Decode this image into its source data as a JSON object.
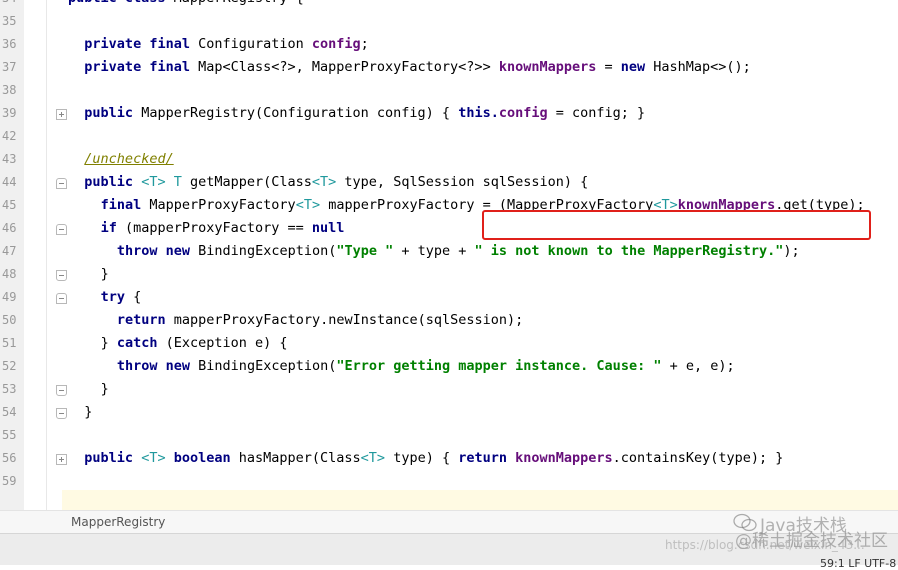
{
  "editor": {
    "lines": [
      {
        "no": "34",
        "indent": 0,
        "fold": "",
        "tokens": [
          [
            "kw",
            "public class "
          ],
          [
            "",
            "MapperRegistry {"
          ]
        ]
      },
      {
        "no": "35",
        "indent": 0,
        "fold": "",
        "tokens": []
      },
      {
        "no": "36",
        "indent": 1,
        "fold": "",
        "tokens": [
          [
            "kw",
            "private final "
          ],
          [
            "",
            "Configuration "
          ],
          [
            "fld",
            "config"
          ],
          [
            "",
            ";"
          ]
        ]
      },
      {
        "no": "37",
        "indent": 1,
        "fold": "",
        "tokens": [
          [
            "kw",
            "private final "
          ],
          [
            "",
            "Map<Class<?>, MapperProxyFactory<?>> "
          ],
          [
            "fld",
            "knownMappers"
          ],
          [
            "",
            " = "
          ],
          [
            "kw",
            "new "
          ],
          [
            "",
            "HashMap<>();"
          ]
        ]
      },
      {
        "no": "38",
        "indent": 0,
        "fold": "",
        "tokens": []
      },
      {
        "no": "39",
        "indent": 1,
        "fold": "plus",
        "tokens": [
          [
            "kw",
            "public "
          ],
          [
            "",
            "MapperRegistry(Configuration config) { "
          ],
          [
            "kw",
            "this."
          ],
          [
            "fld",
            "config"
          ],
          [
            "",
            " = config; }"
          ]
        ]
      },
      {
        "no": "42",
        "indent": 0,
        "fold": "",
        "tokens": []
      },
      {
        "no": "43",
        "indent": 1,
        "fold": "",
        "tokens": [
          [
            "ann",
            "/unchecked/"
          ]
        ]
      },
      {
        "no": "44",
        "indent": 1,
        "fold": "start",
        "tokens": [
          [
            "kw",
            "public "
          ],
          [
            "typ",
            "<T> "
          ],
          [
            "typ",
            "T "
          ],
          [
            "",
            "getMapper(Class"
          ],
          [
            "typ",
            "<T>"
          ],
          [
            "",
            " type, SqlSession sqlSession) {"
          ]
        ]
      },
      {
        "no": "45",
        "indent": 2,
        "fold": "",
        "tokens": [
          [
            "kw",
            "final "
          ],
          [
            "",
            "MapperProxyFactory"
          ],
          [
            "typ",
            "<T>"
          ],
          [
            "",
            " mapperProxyFactory = (MapperProxyFactory"
          ],
          [
            "typ",
            "<T>"
          ],
          [
            ") "
          ],
          [
            "fld",
            "knownMappers"
          ],
          [
            "",
            ".get(type);"
          ]
        ]
      },
      {
        "no": "46",
        "indent": 2,
        "fold": "start",
        "tokens": [
          [
            "kw",
            "if "
          ],
          [
            "",
            "(mapperProxyFactory == "
          ],
          [
            "kw",
            "null"
          ],
          [
            ") {"
          ]
        ]
      },
      {
        "no": "47",
        "indent": 3,
        "fold": "",
        "tokens": [
          [
            "kw",
            "throw new "
          ],
          [
            "",
            "BindingException("
          ],
          [
            "str",
            "\"Type \""
          ],
          [
            "",
            " + type + "
          ],
          [
            "str",
            "\" is not known to the MapperRegistry.\""
          ],
          [
            "",
            ");"
          ]
        ]
      },
      {
        "no": "48",
        "indent": 2,
        "fold": "end",
        "tokens": [
          [
            "",
            "}"
          ]
        ]
      },
      {
        "no": "49",
        "indent": 2,
        "fold": "start",
        "tokens": [
          [
            "kw",
            "try "
          ],
          [
            "",
            "{"
          ]
        ]
      },
      {
        "no": "50",
        "indent": 3,
        "fold": "",
        "tokens": [
          [
            "kw",
            "return "
          ],
          [
            "",
            "mapperProxyFactory.newInstance(sqlSession);"
          ]
        ]
      },
      {
        "no": "51",
        "indent": 2,
        "fold": "",
        "tokens": [
          [
            "",
            "} "
          ],
          [
            "kw",
            "catch "
          ],
          [
            "",
            "(Exception e) {"
          ]
        ]
      },
      {
        "no": "52",
        "indent": 3,
        "fold": "",
        "tokens": [
          [
            "kw",
            "throw new "
          ],
          [
            "",
            "BindingException("
          ],
          [
            "str",
            "\"Error getting mapper instance. Cause: \""
          ],
          [
            "",
            " + e, e);"
          ]
        ]
      },
      {
        "no": "53",
        "indent": 2,
        "fold": "end",
        "tokens": [
          [
            "",
            "}"
          ]
        ]
      },
      {
        "no": "54",
        "indent": 1,
        "fold": "end",
        "tokens": [
          [
            "",
            "}"
          ]
        ]
      },
      {
        "no": "55",
        "indent": 0,
        "fold": "",
        "tokens": []
      },
      {
        "no": "56",
        "indent": 1,
        "fold": "plus",
        "tokens": [
          [
            "kw",
            "public "
          ],
          [
            "typ",
            "<T> "
          ],
          [
            "kw",
            "boolean "
          ],
          [
            "",
            "hasMapper(Class"
          ],
          [
            "typ",
            "<T>"
          ],
          [
            "",
            " type) { "
          ],
          [
            "kw",
            "return "
          ],
          [
            "fld",
            "knownMappers"
          ],
          [
            "",
            ".containsKey(type); }"
          ]
        ]
      },
      {
        "no": "59",
        "indent": 0,
        "fold": "",
        "tokens": []
      }
    ]
  },
  "breadcrumb": {
    "label": "MapperRegistry"
  },
  "status": {
    "position": "59:1 LF UTF-8"
  },
  "watermark": {
    "brand": "Java技术栈",
    "community": "@稀土掘金技术社区",
    "url": "https://blog.csdn.net/weixin_43..."
  }
}
